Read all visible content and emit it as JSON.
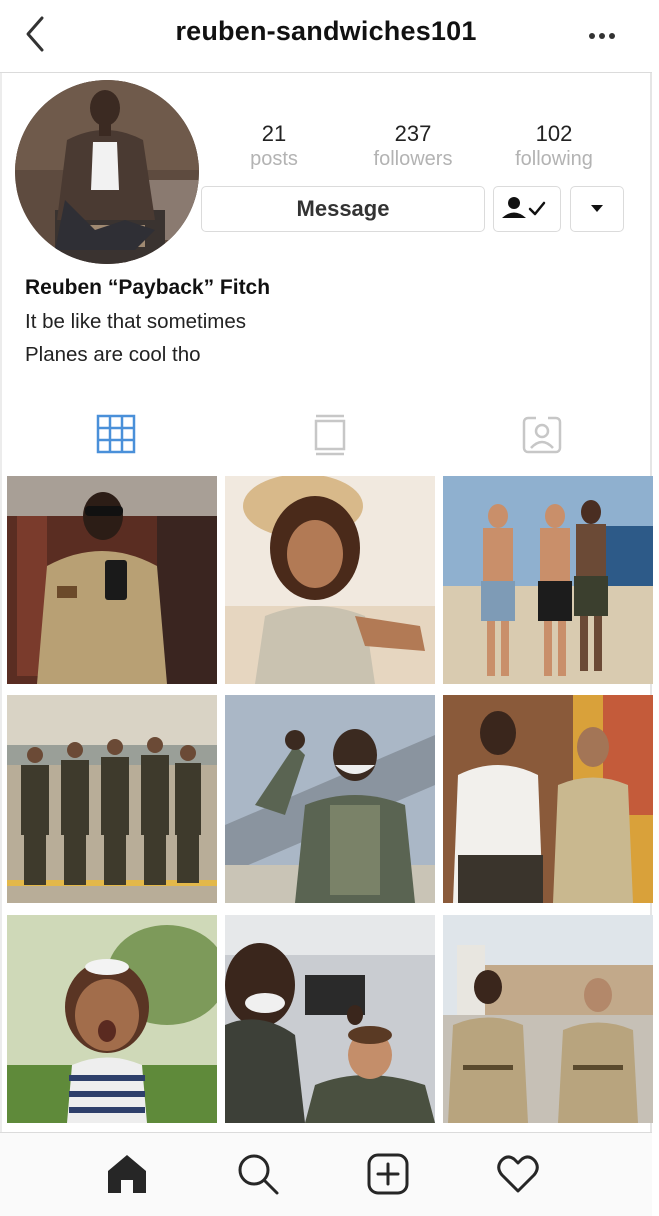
{
  "header": {
    "username": "reuben-sandwiches101",
    "back_icon": "chevron-left-icon",
    "more_icon": "more-horizontal-icon"
  },
  "profile": {
    "stats": [
      {
        "value": "21",
        "label": "posts"
      },
      {
        "value": "237",
        "label": "followers"
      },
      {
        "value": "102",
        "label": "following"
      }
    ],
    "message_label": "Message",
    "following_icon": "person-check-icon",
    "dropdown_icon": "caret-down-icon",
    "full_name": "Reuben “Payback” Fitch",
    "bio_lines": [
      "It be like that sometimes",
      "Planes are cool tho"
    ]
  },
  "tabs": [
    {
      "name": "grid",
      "icon": "grid-icon",
      "active": true
    },
    {
      "name": "feed",
      "icon": "feed-icon",
      "active": false
    },
    {
      "name": "tagged",
      "icon": "tagged-icon",
      "active": false
    }
  ],
  "posts": [
    {
      "alt": "mirror selfie in khaki uniform"
    },
    {
      "alt": "woman selfie on beach"
    },
    {
      "alt": "three shirtless men on beach"
    },
    {
      "alt": "five pilots on runway"
    },
    {
      "alt": "smiling pilot pointing at jet"
    },
    {
      "alt": "two men posing against wall"
    },
    {
      "alt": "toddler surprised face"
    },
    {
      "alt": "selfie with two men"
    },
    {
      "alt": "two men in khaki uniforms"
    }
  ],
  "bottom_nav": [
    {
      "name": "home",
      "icon": "home-icon"
    },
    {
      "name": "search",
      "icon": "search-icon"
    },
    {
      "name": "new-post",
      "icon": "add-post-icon"
    },
    {
      "name": "activity",
      "icon": "heart-icon"
    }
  ],
  "colors": {
    "active_tab": "#4a90d9",
    "inactive_tab": "#c7c7c7",
    "divider": "#dbdbdb",
    "secondary_text": "#b3b3b3"
  }
}
